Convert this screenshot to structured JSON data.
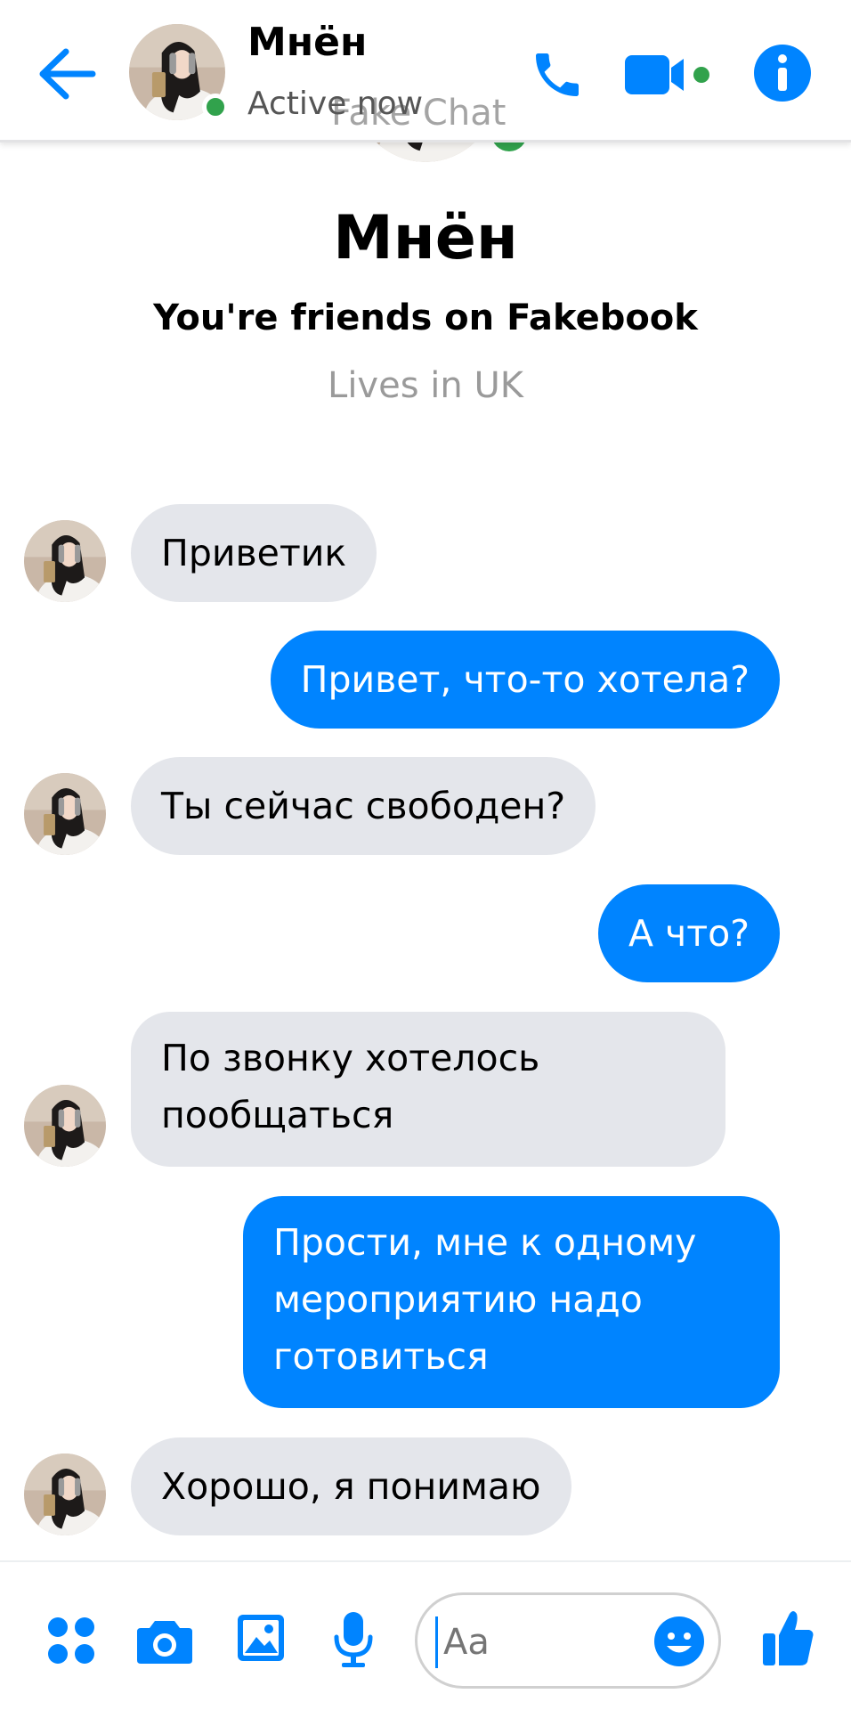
{
  "header": {
    "name": "Мнён",
    "status": "Active now",
    "watermark": "Fake Chat"
  },
  "profile": {
    "name": "Мнён",
    "friends_text": "You're friends on Fakebook",
    "location": "Lives in UK"
  },
  "messages": [
    {
      "from": "them",
      "text": "Приветик"
    },
    {
      "from": "me",
      "text": "Привет, что-то хотела?"
    },
    {
      "from": "them",
      "text": "Ты сейчас свободен?"
    },
    {
      "from": "me",
      "text": "А что?"
    },
    {
      "from": "them",
      "lines": [
        "По звонку хотелось",
        "пообщаться"
      ]
    },
    {
      "from": "me",
      "lines": [
        "Прости, мне к одному",
        "мероприятию надо",
        "готовиться"
      ]
    },
    {
      "from": "them",
      "text": "Хорошо, я понимаю"
    }
  ],
  "composer": {
    "placeholder": "Aa"
  },
  "icons": {
    "back": "back-arrow-icon",
    "call": "phone-icon",
    "video": "video-camera-icon",
    "info": "info-icon",
    "apps": "apps-grid-icon",
    "camera": "camera-icon",
    "gallery": "image-icon",
    "mic": "microphone-icon",
    "emoji": "emoji-icon",
    "like": "thumbs-up-icon"
  },
  "colors": {
    "accent": "#0084ff",
    "incoming_bubble": "#e4e6eb",
    "online": "#31a24c",
    "muted_text": "#9a9a9a"
  }
}
